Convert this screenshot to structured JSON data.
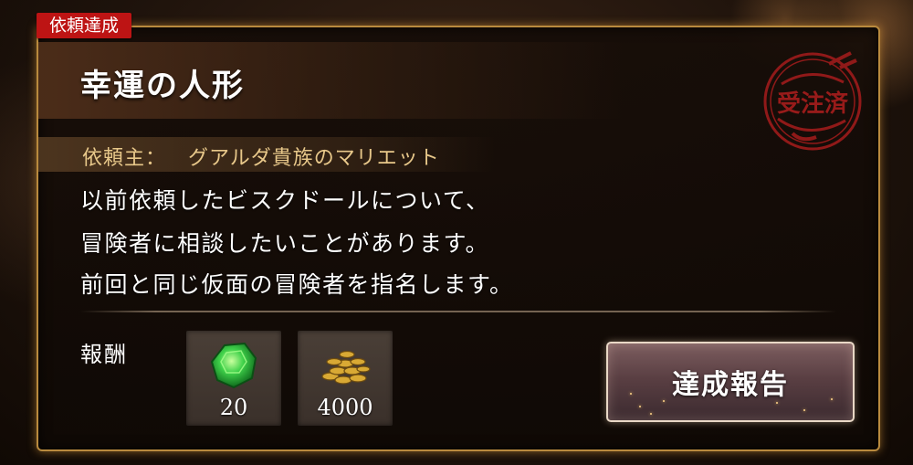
{
  "badge": {
    "label": "依頼達成"
  },
  "request": {
    "title": "幸運の人形",
    "client_label": "依頼主：",
    "client_name": "グアルダ貴族のマリエット",
    "description_lines": [
      "以前依頼したビスクドールについて、",
      "冒険者に相談したいことがあります。",
      "前回と同じ仮面の冒険者を指名します。"
    ]
  },
  "stamp": {
    "text": "受注済",
    "color": "#b01e1e"
  },
  "rewards": {
    "label": "報酬",
    "items": [
      {
        "icon": "emerald-gem-icon",
        "count": "20",
        "color": "#2fbf3a"
      },
      {
        "icon": "gold-coins-icon",
        "count": "4000",
        "color": "#d4a83a"
      }
    ]
  },
  "actions": {
    "complete_label": "達成報告"
  }
}
